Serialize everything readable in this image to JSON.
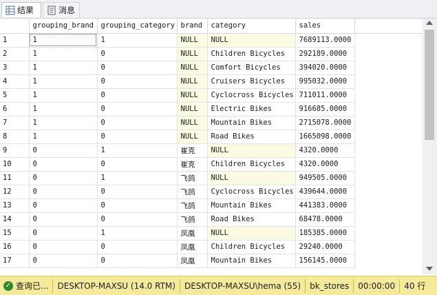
{
  "tabs": [
    {
      "label": "结果",
      "icon": "results-grid-icon",
      "active": true
    },
    {
      "label": "消息",
      "icon": "messages-icon",
      "active": false
    }
  ],
  "columns": [
    "grouping_brand",
    "grouping_category",
    "brand",
    "category",
    "sales"
  ],
  "rows": [
    {
      "n": "1",
      "gb": "1",
      "gc": "1",
      "brand": "NULL",
      "category": "NULL",
      "sales": "7689113.0000"
    },
    {
      "n": "2",
      "gb": "1",
      "gc": "0",
      "brand": "NULL",
      "category": "Children Bicycles",
      "sales": "292189.0000"
    },
    {
      "n": "3",
      "gb": "1",
      "gc": "0",
      "brand": "NULL",
      "category": "Comfort Bicycles",
      "sales": "394020.0000"
    },
    {
      "n": "4",
      "gb": "1",
      "gc": "0",
      "brand": "NULL",
      "category": "Cruisers Bicycles",
      "sales": "995032.0000"
    },
    {
      "n": "5",
      "gb": "1",
      "gc": "0",
      "brand": "NULL",
      "category": "Cyclocross Bicycles",
      "sales": "711011.0000"
    },
    {
      "n": "6",
      "gb": "1",
      "gc": "0",
      "brand": "NULL",
      "category": "Electric Bikes",
      "sales": "916685.0000"
    },
    {
      "n": "7",
      "gb": "1",
      "gc": "0",
      "brand": "NULL",
      "category": "Mountain Bikes",
      "sales": "2715078.0000"
    },
    {
      "n": "8",
      "gb": "1",
      "gc": "0",
      "brand": "NULL",
      "category": "Road Bikes",
      "sales": "1665098.0000"
    },
    {
      "n": "9",
      "gb": "0",
      "gc": "1",
      "brand": "崔克",
      "category": "NULL",
      "sales": "4320.0000"
    },
    {
      "n": "10",
      "gb": "0",
      "gc": "0",
      "brand": "崔克",
      "category": "Children Bicycles",
      "sales": "4320.0000"
    },
    {
      "n": "11",
      "gb": "0",
      "gc": "1",
      "brand": "飞鸽",
      "category": "NULL",
      "sales": "949505.0000"
    },
    {
      "n": "12",
      "gb": "0",
      "gc": "0",
      "brand": "飞鸽",
      "category": "Cyclocross Bicycles",
      "sales": "439644.0000"
    },
    {
      "n": "13",
      "gb": "0",
      "gc": "0",
      "brand": "飞鸽",
      "category": "Mountain Bikes",
      "sales": "441383.0000"
    },
    {
      "n": "14",
      "gb": "0",
      "gc": "0",
      "brand": "飞鸽",
      "category": "Road Bikes",
      "sales": "68478.0000"
    },
    {
      "n": "15",
      "gb": "0",
      "gc": "1",
      "brand": "凤凰",
      "category": "NULL",
      "sales": "185385.0000"
    },
    {
      "n": "16",
      "gb": "0",
      "gc": "0",
      "brand": "凤凰",
      "category": "Children Bicycles",
      "sales": "29240.0000"
    },
    {
      "n": "17",
      "gb": "0",
      "gc": "0",
      "brand": "凤凰",
      "category": "Mountain Bikes",
      "sales": "156145.0000"
    }
  ],
  "status": {
    "query_state": "查询已...",
    "server": "DESKTOP-MAXSU (14.0 RTM)",
    "login": "DESKTOP-MAXSU\\hema (55)",
    "database": "bk_stores",
    "elapsed": "00:00:00",
    "row_count": "40 行"
  },
  "colors": {
    "status_bar": "#f5e99a",
    "null_highlight": "#fbfbe1",
    "ok_icon": "#2e8a2e"
  }
}
